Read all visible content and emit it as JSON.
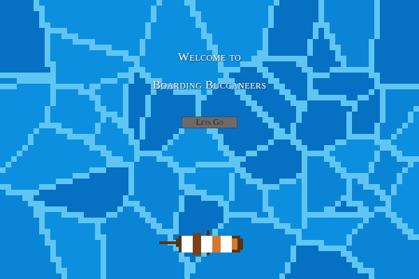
{
  "title": {
    "lines": [
      "Welcome to",
      "Boarding Buccaneers"
    ]
  },
  "start_button": {
    "label": "Lets Go"
  }
}
